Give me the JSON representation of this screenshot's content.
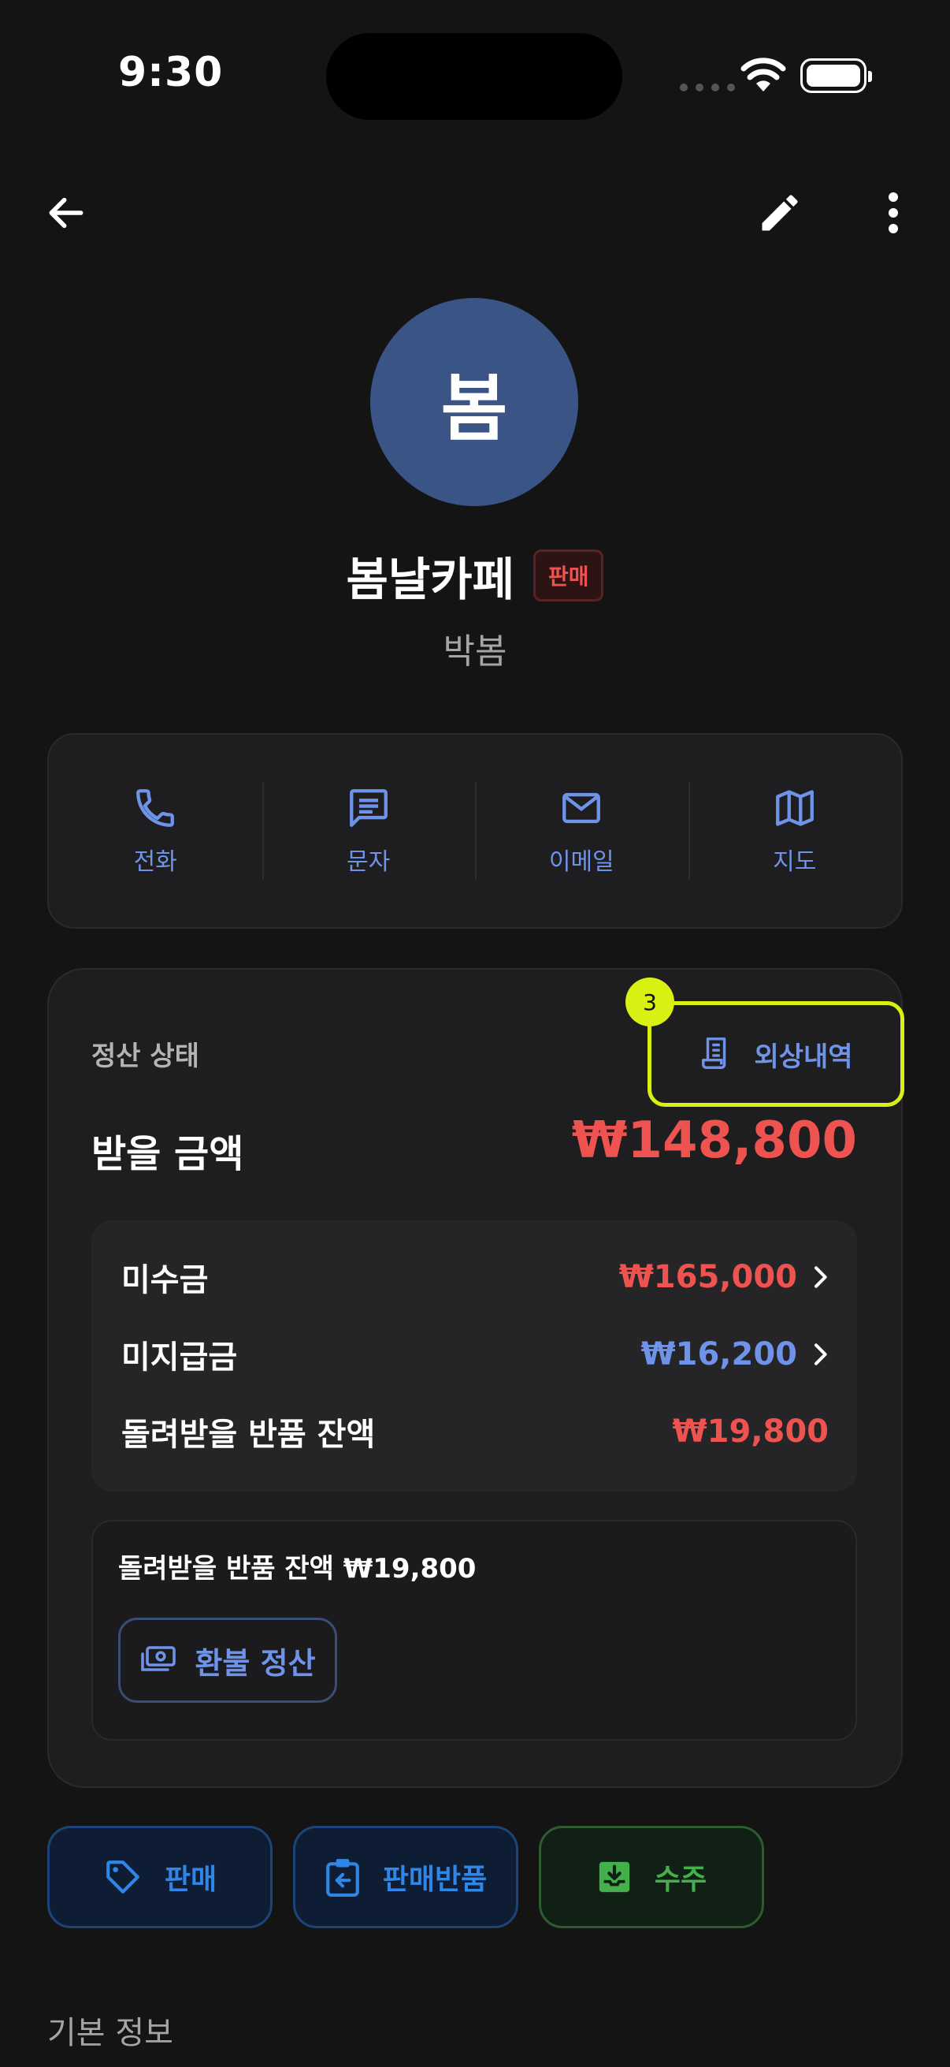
{
  "status_bar": {
    "time": "9:30"
  },
  "profile": {
    "avatar_text": "봄",
    "name": "봄날카페",
    "type_badge": "판매",
    "contact_name": "박봄"
  },
  "actions": [
    {
      "label": "전화",
      "icon": "phone-icon"
    },
    {
      "label": "문자",
      "icon": "message-icon"
    },
    {
      "label": "이메일",
      "icon": "mail-icon"
    },
    {
      "label": "지도",
      "icon": "map-icon"
    }
  ],
  "settlement": {
    "status_label": "정산 상태",
    "ledger_button": "외상내역",
    "marker": "3",
    "receivable_label": "받을 금액",
    "receivable_amount": "₩148,800",
    "rows": [
      {
        "label": "미수금",
        "value": "₩165,000",
        "color": "#ef5350"
      },
      {
        "label": "미지급금",
        "value": "₩16,200",
        "color": "#6e93e8"
      },
      {
        "label": "돌려받을 반품 잔액",
        "value": "₩19,800",
        "color": "#ef5350"
      }
    ],
    "refund_text": "돌려받을 반품 잔액 ₩19,800",
    "refund_button": "환불 정산"
  },
  "transactions": {
    "sale": "판매",
    "sale_return": "판매반품",
    "order": "수주"
  },
  "section_title": "기본 정보",
  "colors": {
    "accent": "#6e93e8",
    "negative": "#ef5350",
    "highlight": "#d9f112",
    "positive": "#43b04b"
  }
}
